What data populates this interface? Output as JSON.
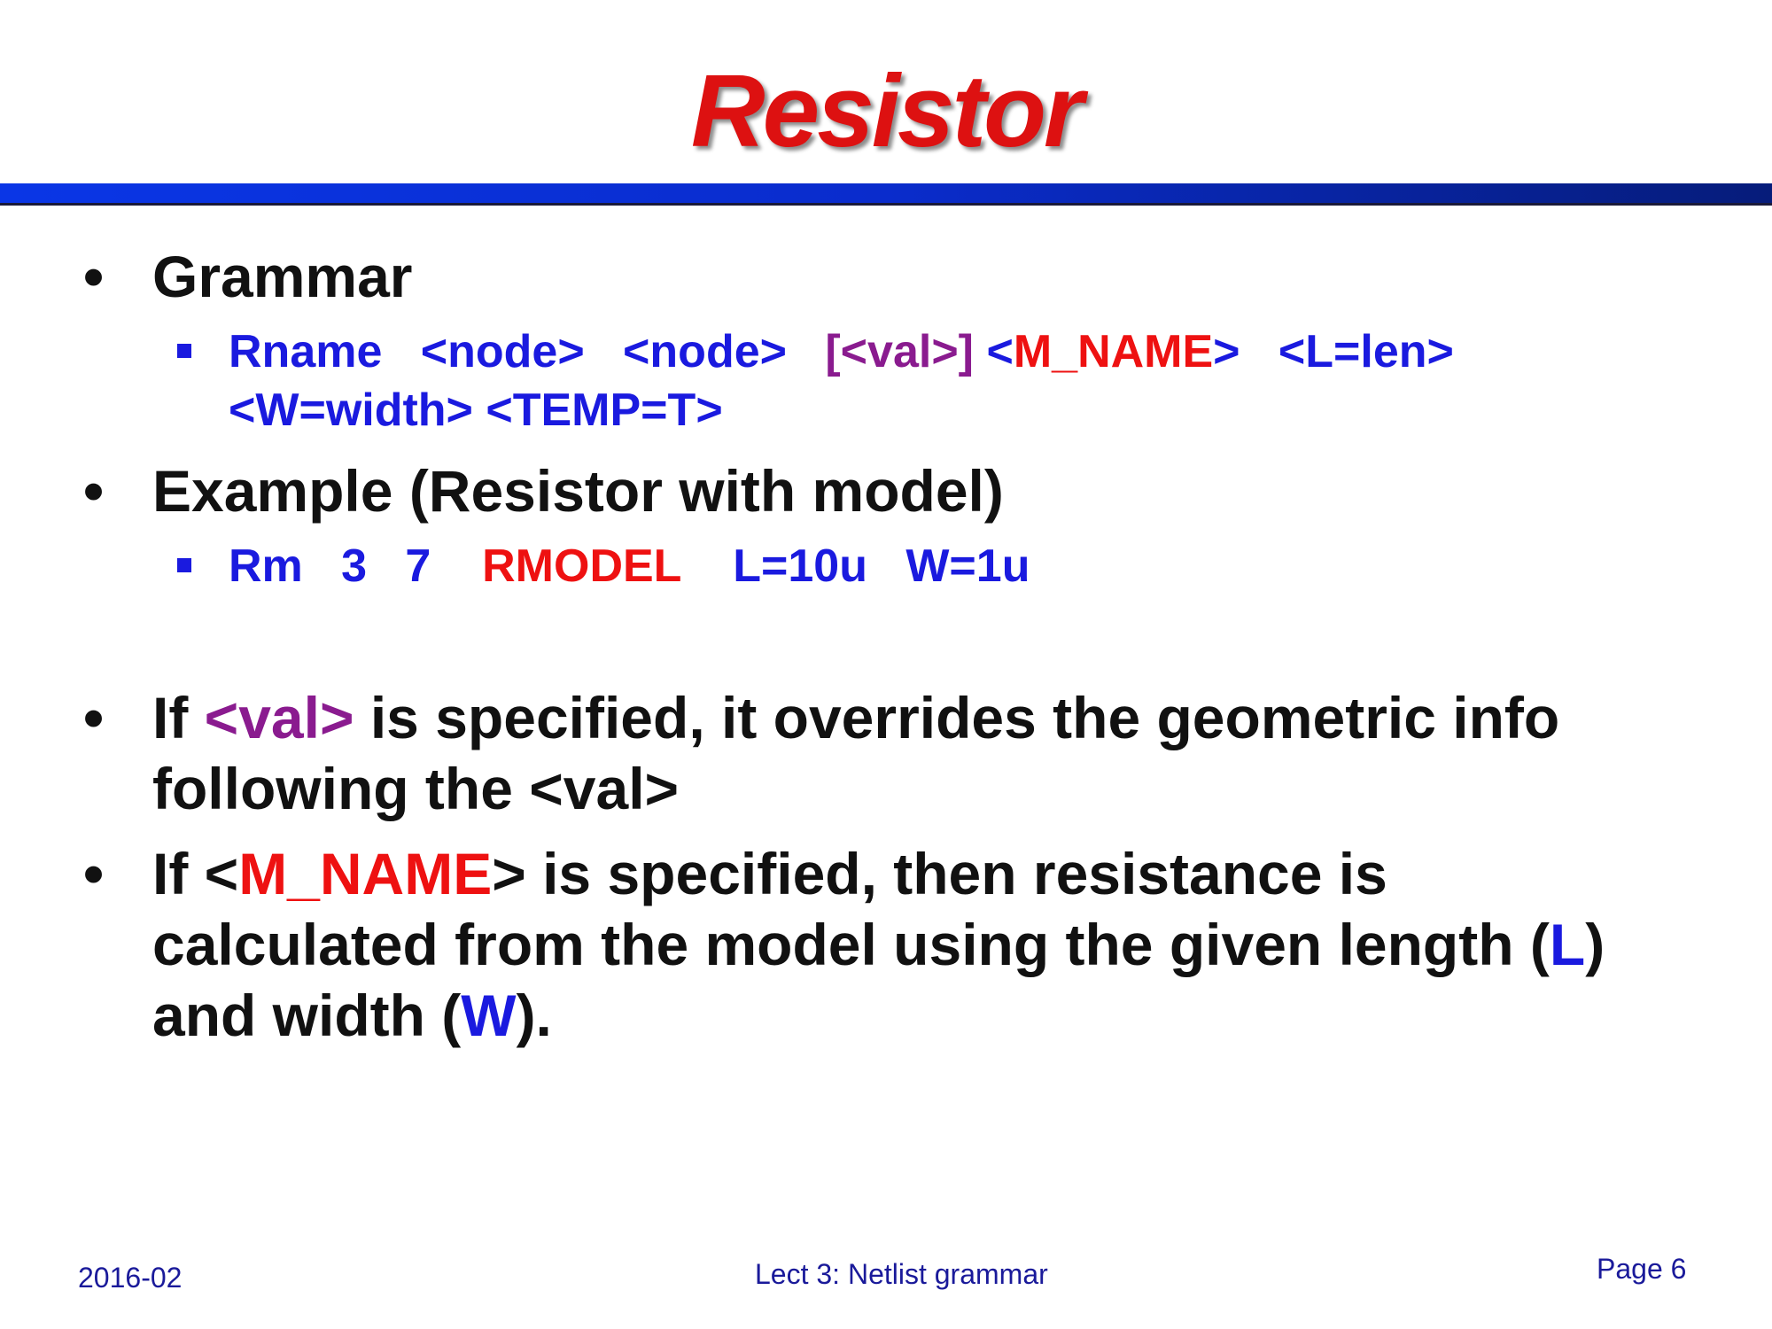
{
  "title": "Resistor",
  "bullets": {
    "grammar": {
      "label": "Grammar",
      "syntax_line1": {
        "rname": "Rname",
        "node1": "<node>",
        "node2": "<node>",
        "val": "[<val>]",
        "mname": "<M_NAME>",
        "len": "<L=len>"
      },
      "syntax_line2": "<W=width> <TEMP=T>"
    },
    "example": {
      "label": "Example (Resistor with model)",
      "rm": "Rm",
      "n1": "3",
      "n2": "7",
      "model": "RMODEL",
      "l": "L=10u",
      "w": "W=1u"
    },
    "val_note": {
      "p1": "If ",
      "val": "<val>",
      "p2": " is specified, it overrides the geometric info",
      "line2": "following the <val>"
    },
    "mname_note": {
      "p1": "If <",
      "mname": "M_NAME",
      "p2": "> is specified, then resistance is",
      "line2a": "calculated from the model using the given length (",
      "L": "L",
      "line2b": ")",
      "line3a": "and width (",
      "W": "W",
      "line3b": ")."
    }
  },
  "footer": {
    "date": "2016-02",
    "center": "Lect 3: Netlist grammar",
    "page": "Page 6"
  },
  "colors": {
    "title": "#dd1111",
    "keyword_blue": "#1a1adf",
    "val_purple": "#8a1b8f",
    "model_red": "#ee1111",
    "rule_blue": "#0a36e6"
  }
}
